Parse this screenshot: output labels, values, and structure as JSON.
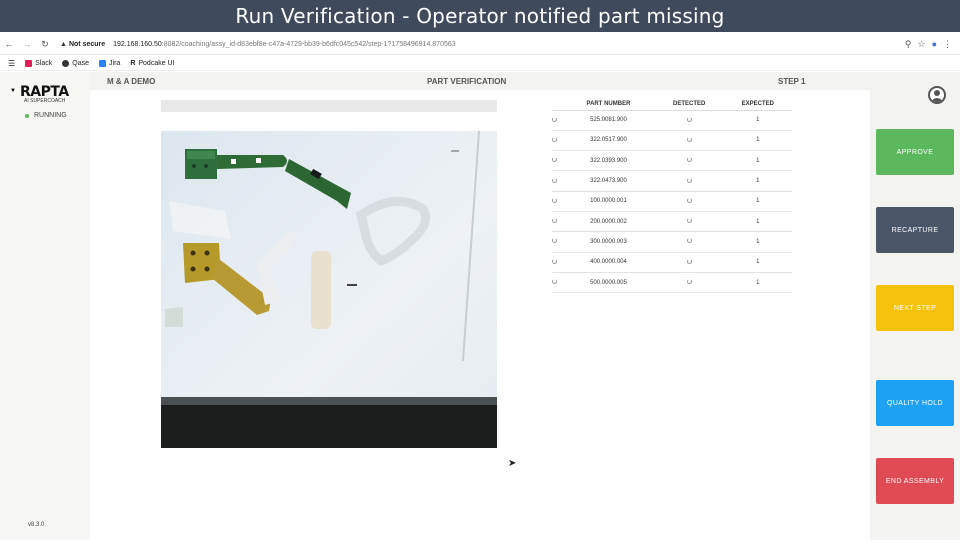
{
  "title_bar": "Run Verification - Operator notified part missing",
  "browser": {
    "security": "Not secure",
    "host": "192.168.160.50",
    "path": ":8082/coaching/assy_id-d83ebf8e-c47a-4729-bb39-b6dfc045c542/step-1?1758496914.870563",
    "bookmarks": [
      "Slack",
      "Qase",
      "Jira",
      "Podcake UI"
    ]
  },
  "sidebar": {
    "logo": "RAPTA",
    "logo_sub": "AI SUPERCOACH",
    "status": "RUNNING",
    "version": "v8.3.0"
  },
  "header": {
    "left": "M & A DEMO",
    "center": "PART VERIFICATION",
    "right": "STEP 1"
  },
  "table": {
    "columns": [
      "PART NUMBER",
      "DETECTED",
      "EXPECTED"
    ],
    "rows": [
      {
        "part": "525.0081.900",
        "expected": "1"
      },
      {
        "part": "322.0517.900",
        "expected": "1"
      },
      {
        "part": "322.0393.900",
        "expected": "1"
      },
      {
        "part": "322.0473.900",
        "expected": "1"
      },
      {
        "part": "100.0000.001",
        "expected": "1"
      },
      {
        "part": "200.0000.002",
        "expected": "1"
      },
      {
        "part": "300.0000.003",
        "expected": "1"
      },
      {
        "part": "400.0000.004",
        "expected": "1"
      },
      {
        "part": "500.0000.005",
        "expected": "1"
      }
    ]
  },
  "actions": {
    "approve": "APPROVE",
    "recapture": "RECAPTURE",
    "next_step": "NEXT STEP",
    "quality_hold": "QUALITY HOLD",
    "end_assembly": "END ASSEMBLY"
  },
  "colors": {
    "approve": "#5cb85c",
    "recapture": "#4a5568",
    "next_step": "#f4c20d",
    "quality_hold": "#1da1f2",
    "end_assembly": "#e04a55"
  }
}
